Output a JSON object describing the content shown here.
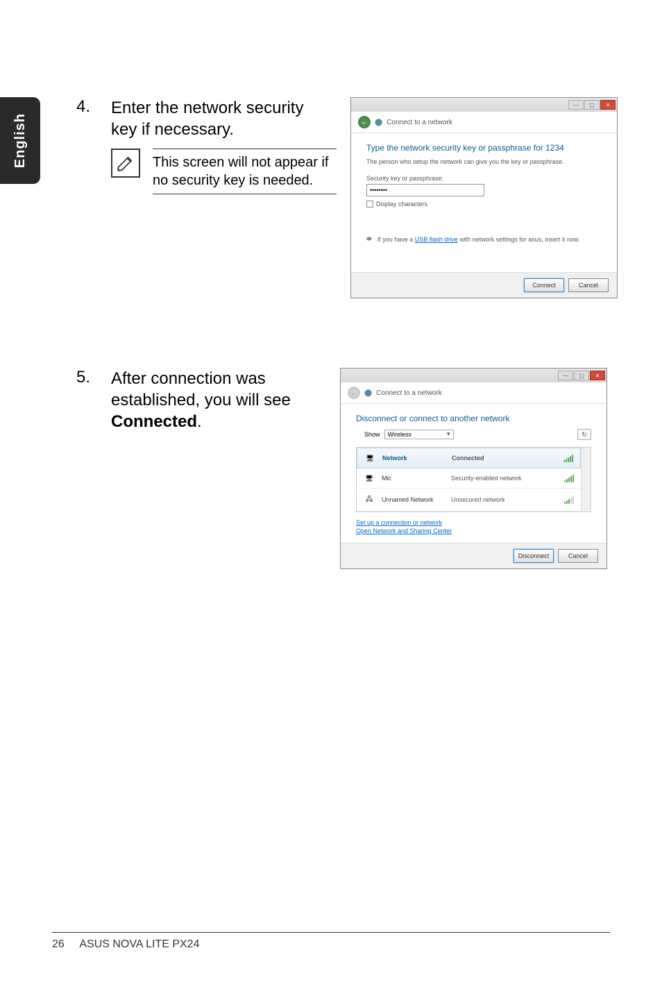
{
  "sidebar": {
    "language": "English"
  },
  "step4": {
    "num": "4.",
    "text": "Enter the network security key if necessary.",
    "note": "This screen will not appear if no security key is needed."
  },
  "dialog1": {
    "nav_title": "Connect to a network",
    "heading": "Type the network security key or passphrase for 1234",
    "subtext": "The person who setup the network can give you the key or passphrase.",
    "field_label": "Security key or passphrase:",
    "field_value": "••••••••",
    "display_chars": "Display characters",
    "usb_prefix": "If you have a ",
    "usb_link": "USB flash drive",
    "usb_suffix": " with network settings for asus, insert it now.",
    "btn_connect": "Connect",
    "btn_cancel": "Cancel"
  },
  "step5": {
    "num": "5.",
    "text_prefix": "After connection was established, you will see ",
    "text_bold": "Connected",
    "text_suffix": "."
  },
  "dialog2": {
    "nav_title": "Connect to a network",
    "heading": "Disconnect or connect to another network",
    "show_label": "Show",
    "show_value": "Wireless",
    "networks": [
      {
        "name": "Network",
        "status": "Connected",
        "selected": true,
        "icon": "pc"
      },
      {
        "name": "Mic",
        "status": "Security-enabled network",
        "selected": false,
        "icon": "pc"
      },
      {
        "name": "Unnamed Network",
        "status": "Unsecured network",
        "selected": false,
        "icon": "net"
      }
    ],
    "link1": "Set up a connection or network",
    "link2": "Open Network and Sharing Center",
    "btn_disconnect": "Disconnect",
    "btn_cancel": "Cancel"
  },
  "footer": {
    "page": "26",
    "title": "ASUS NOVA LITE PX24"
  }
}
